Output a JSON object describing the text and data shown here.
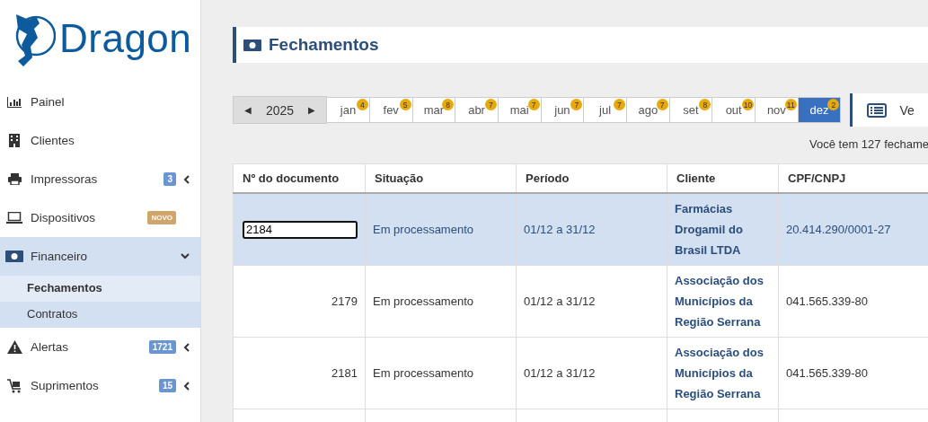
{
  "sidebar": {
    "logo": "Dragon",
    "items": [
      {
        "label": "Painel",
        "expandable": false,
        "expanded": false
      },
      {
        "label": "Clientes",
        "expandable": false,
        "expanded": false
      },
      {
        "label": "Impressoras",
        "badge": "3",
        "color": "#6a95d1",
        "expandable": true,
        "expanded": false
      },
      {
        "label": "Dispositivos",
        "badge": "NOVO",
        "color": "#d0a56b",
        "expandable": false,
        "expanded": false
      },
      {
        "label": "Financeiro",
        "expandable": true,
        "expanded": true,
        "children": [
          {
            "label": "Fechamentos",
            "selected": true
          },
          {
            "label": "Contratos",
            "selected": false
          }
        ]
      },
      {
        "label": "Alertas",
        "badge": "1721",
        "color": "#6a95d1",
        "expandable": true,
        "expanded": false
      },
      {
        "label": "Suprimentos",
        "badge": "15",
        "color": "#6a95d1",
        "expandable": true,
        "expanded": false
      }
    ]
  },
  "header": {
    "title": "Fechamentos"
  },
  "year": {
    "value": "2025",
    "prev": "◀",
    "next": "▶"
  },
  "months": [
    {
      "label": "jan",
      "count": "4",
      "selected": false
    },
    {
      "label": "fev",
      "count": "5",
      "selected": false
    },
    {
      "label": "mar",
      "count": "8",
      "selected": false
    },
    {
      "label": "abr",
      "count": "7",
      "selected": false
    },
    {
      "label": "mai",
      "count": "7",
      "selected": false
    },
    {
      "label": "jun",
      "count": "7",
      "selected": false
    },
    {
      "label": "jul",
      "count": "7",
      "selected": false
    },
    {
      "label": "ago",
      "count": "7",
      "selected": false
    },
    {
      "label": "set",
      "count": "8",
      "selected": false
    },
    {
      "label": "out",
      "count": "10",
      "selected": false
    },
    {
      "label": "nov",
      "count": "11",
      "selected": false
    },
    {
      "label": "dez",
      "count": "2",
      "selected": true
    }
  ],
  "view_button": "Ve",
  "summary": "Você tem 127 fechame",
  "table": {
    "columns": [
      "Nº do documento",
      "Situação",
      "Período",
      "Cliente",
      "CPF/CNPJ"
    ],
    "rows": [
      {
        "selected": true,
        "editing": true,
        "document": "2184",
        "status": "Em processamento",
        "period": "01/12 a 31/12",
        "client": "Farmácias Drogamil do Brasil LTDA",
        "tax_id": "20.414.290/0001-27"
      },
      {
        "selected": false,
        "editing": false,
        "document": "2179",
        "status": "Em processamento",
        "period": "01/12 a 31/12",
        "client": "Associação dos Municípios da Região Serrana",
        "tax_id": "041.565.339-80"
      },
      {
        "selected": false,
        "editing": false,
        "document": "2181",
        "status": "Em processamento",
        "period": "01/12 a 31/12",
        "client": "Associação dos Municípios da Região Serrana",
        "tax_id": "041.565.339-80"
      }
    ]
  }
}
